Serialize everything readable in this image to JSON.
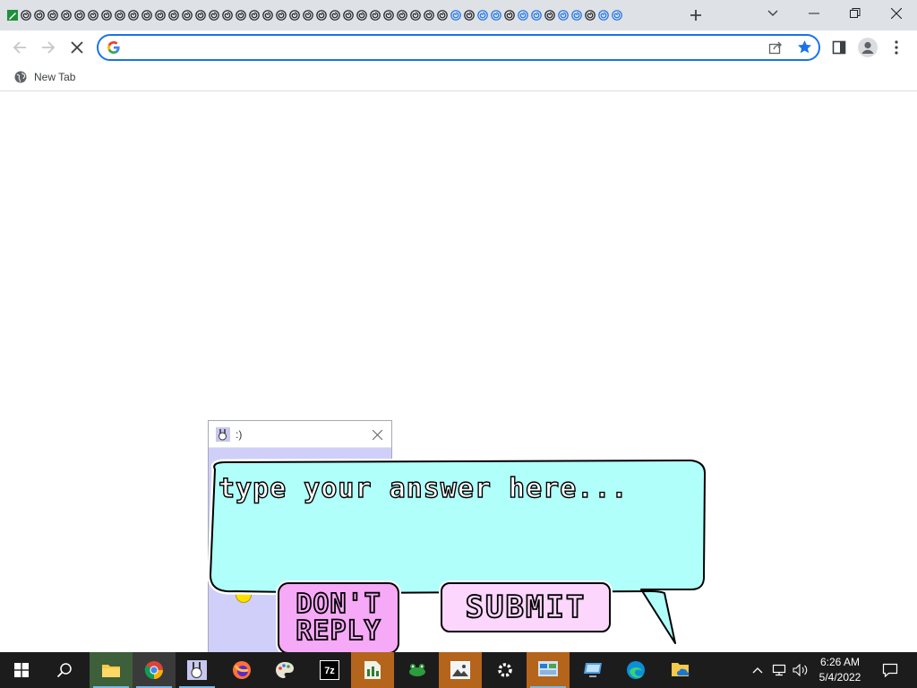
{
  "browser": {
    "tab_count": 46,
    "new_tab_tooltip": "New tab",
    "address_bar": {
      "value": "",
      "placeholder": ""
    },
    "bookmarks": [
      {
        "label": "New Tab"
      }
    ]
  },
  "popup": {
    "title": ":)",
    "input_placeholder": "type your answer here...",
    "dont_reply_label": "DON'T\nREPLY",
    "submit_label": "SUBMIT"
  },
  "taskbar": {
    "apps": [
      "start",
      "search",
      "file-explorer",
      "chrome",
      "paint-bunny",
      "firefox",
      "paint",
      "7zip",
      "spreadsheet",
      "frog-app",
      "photos",
      "settings",
      "control-panel",
      "remote-desktop",
      "edge",
      "folder-cloud"
    ],
    "clock": {
      "time": "6:26 AM",
      "date": "5/4/2022"
    }
  },
  "colors": {
    "accent": "#1a73e8",
    "bubble_fill": "#b0fffa",
    "dont_reply_fill": "#f6a9f6",
    "submit_fill": "#fcd6fc",
    "popup_bg": "#cfcff9",
    "taskbar_bg": "#1c1c1c"
  }
}
